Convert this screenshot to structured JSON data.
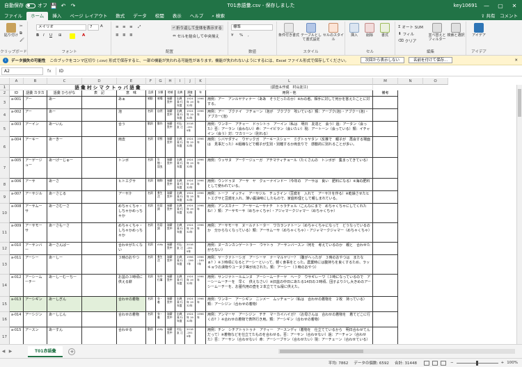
{
  "titlebar": {
    "autosave_label": "自動保存",
    "autosave_state": "オフ",
    "file_title": "T01赤語彙.csv - 保存しました",
    "user": "key10691",
    "share_label": "共有",
    "comment_label": "コメント"
  },
  "tabs": [
    "ファイル",
    "ホーム",
    "挿入",
    "ページ レイアウト",
    "数式",
    "データ",
    "校閲",
    "表示",
    "ヘルプ"
  ],
  "active_tab": "ホーム",
  "search_label": "検索",
  "ribbon": {
    "clipboard": {
      "paste": "貼り付け",
      "label": "クリップボード"
    },
    "font": {
      "name": "メイリオ",
      "size": "7",
      "label": "フォント"
    },
    "alignment": {
      "wrap": "折り返して全体を表示する",
      "merge": "セルを結合して中央揃え",
      "label": "配置"
    },
    "number": {
      "format": "標準",
      "label": "数値"
    },
    "styles": {
      "conditional": "条件付き書式",
      "table": "テーブルとして書式設定",
      "cell": "セルのスタイル",
      "label": "スタイル"
    },
    "cells": {
      "insert": "挿入",
      "delete": "削除",
      "format": "書式",
      "label": "セル"
    },
    "editing": {
      "autosum": "オート SUM",
      "fill": "フィル",
      "clear": "クリア",
      "sort": "並べ替えとフィルター",
      "find": "検索と選択",
      "label": "編集"
    },
    "ideas": {
      "ideas": "アイデア",
      "label": "アイデア"
    }
  },
  "message_bar": {
    "title": "データ損失の可能性",
    "text": "このブックをコンマ区切り (.csv) 形式で保存すると、一部の機能が失われる可能性があります。機能が失われないようにするには、Excel ファイル形式で保存してください。",
    "btn_dont_show": "次回から表示しない",
    "btn_save_as": "名前を付けて保存..."
  },
  "formula_bar": {
    "namebox": "A2",
    "fx": "fx",
    "value": "ID"
  },
  "columns": [
    "A",
    "B",
    "C",
    "D",
    "E",
    "F",
    "G",
    "H",
    "I",
    "J",
    "K",
    "L",
    "M",
    "N",
    "O"
  ],
  "sheet": {
    "title": "語 彙 村 シ マ ク ト ゥ バ 語 彙",
    "credit": "(調査＆作成　村山友江)",
    "headers": [
      "ID",
      "語彙 カタカナ",
      "語彙 ひらがな",
      "表　記",
      "意　味",
      "品詞",
      "分類",
      "地域",
      "出典",
      "調査年",
      "年",
      "用例・他",
      "備考"
    ],
    "rows": [
      {
        "id": "a-001",
        "kata": "アー",
        "hira": "あー",
        "hyoki": "",
        "imi": "あぁ",
        "hinshi": "感動",
        "bunrui": "感嘆",
        "chiiki": "瑞慶 覧中",
        "shuten": "出典発 行年度",
        "nen1": "1924年 1932年",
        "nen2": "1996年",
        "yorei": "用例：アー　アンルヤティナー（ああ　そうだったのか）※わの者。相手に対して何かを答えたことに対する。"
      },
      {
        "id": "a-002",
        "kata": "アー",
        "hira": "あー",
        "hyoki": "",
        "imi": "泡",
        "hinshi": "名詞",
        "bunrui": "自然",
        "chiiki": "瑞慶 覧中",
        "shuten": "出典発 行年度",
        "nen1": "1924年 1932年",
        "nen2": "1996年",
        "yorei": "用例：アー　ブクナイ　フチョーン（泡が　ブクブク　吹いている）類：アーブク(泡)・アブクー(泡)・アブカー(泡)"
      },
      {
        "id": "a-003",
        "kata": "アーイン",
        "hira": "あーいん",
        "hyoki": "",
        "imi": "合う",
        "hinshi": "動詞",
        "bunrui": "動作",
        "chiiki": "瑞慶 覧中",
        "shuten": "村山友 江",
        "nen1": "2018-2019年",
        "nen2": "",
        "yorei": "用例：ワンネー　アチャー　ドゥシトゥ　アーイン（私は　明日　友達と　会う）過：アータン（会った）否：アーラン（会わない）命：アーイビラン（会いたい）現：アートーン（会っている）類：イチャイン（会う）対：ワカリーン（別れる）"
      },
      {
        "id": "a-004",
        "kata": "アーキー",
        "hira": "あーきー",
        "hyoki": "",
        "imi": "両去",
        "hinshi": "名詞",
        "bunrui": "状態",
        "chiiki": "瑞慶 覧中",
        "shuten": "出典発 行年度",
        "nen1": "1924年 1932年",
        "nen2": "1996年",
        "yorei": "用例：シバヤダティ　ウヤックガ　アーキースシェー　ミグトゥヤタン（反推で　親子が　再会する場面は　見事だった）※組織などで親子が生別・別離するか両去りで　感動的に別れることが多い。"
      },
      {
        "id": "a-005",
        "kata": "アーゲージュー",
        "hira": "あーげーじゅー",
        "hyoki": "",
        "imi": "トンボ",
        "hinshi": "名詞",
        "bunrui": "生物・昆虫",
        "chiiki": "瑞慶 覧中",
        "shuten": "出典発 行年度",
        "nen1": "1924年 1932年",
        "nen2": "1996年",
        "yorei": "用例：ウッサヌ　アーケージューガ　アチマティチョール（たくさんの　トンボが　集まってきている）"
      },
      {
        "id": "a-006",
        "kata": "アーサ",
        "hira": "あーさ",
        "hyoki": "",
        "imi": "ヒトエグサ",
        "hinshi": "名詞",
        "bunrui": "植物",
        "chiiki": "瑞慶 覧中",
        "shuten": "出典発 行年度",
        "nen1": "1924年 1932年",
        "nen2": "1996年",
        "yorei": "用例：ウンドゥヌ　アーサ　ヤ　クェーナインドー（今年の　アーサは　良い　肥料になる）※海の肥料として使われている。"
      },
      {
        "id": "a-007",
        "kata": "アーサジル",
        "hira": "あーさじる",
        "hyoki": "",
        "imi": "アーサ汁",
        "hinshi": "名詞",
        "bunrui": "食生活",
        "chiiki": "瑞慶 覧中",
        "shuten": "出典発 行年度",
        "nen1": "1924年 1932年",
        "nen2": "1996年",
        "yorei": "用例：トーフ　イッティ　アーサジル　チュクイン（豆腐を　入れて　アーサ汁を作る）※乾燥させたヒトエグサと豆腐を入れ、薄い醤油味にしたもので、家庭料理として親しまれている。"
      },
      {
        "id": "a-008",
        "kata": "アーサムーサ",
        "hira": "あーさむーさ",
        "hyoki": "",
        "imi": "めちゃくちゃ・しちゃかめっちゃか",
        "hinshi": "名詞",
        "bunrui": "形容詞",
        "chiiki": "瑞慶 覧中",
        "shuten": "出典発 行年度",
        "nen1": "1924年 1932年",
        "nen2": "1996年",
        "yorei": "用例：アンスカナー　アーサームーサナチ　トゥラチェル（こんなにまで　めちゃくちゃにしてくれたね！）類：アーサモーサ（めちゃくちゃ）・アジャマークジャマー（めちゃくちゃ）"
      },
      {
        "id": "a-009",
        "kata": "アーサモーサ",
        "hira": "あーさもーさ",
        "hyoki": "",
        "imi": "めちゃくちゃ・しちゃかめっちゃか",
        "hinshi": "名詞",
        "bunrui": "形容詞",
        "chiiki": "瑞慶 覧中",
        "shuten": "出典発 行年度",
        "nen1": "1924年 1932年",
        "nen2": "1996年",
        "yorei": "用例：アーサモーサ　ヌールナトーター　ワカランナトーン（めちゃくちゃになって　どうなっているのか　分からなくなっている）類：アーサムーサ（めちゃくちゃ）・アジャマークジャマー（めちゃくちゃ）"
      },
      {
        "id": "a-010",
        "kata": "アーサンバー",
        "hira": "あーさんばー",
        "hyoki": "",
        "imi": "合わせがたくない",
        "hinshi": "名詞",
        "bunrui": "Allfy",
        "chiiki": "瑞慶 覧中",
        "shuten": "村山友 江",
        "nen1": "2018-2019年",
        "nen2": "",
        "yorei": "用例：ヌーカンカンゲートラー　ウヤトゥ　アーサンバースン（何を　考えているのか　親と　合わせたがらない）"
      },
      {
        "id": "a-011",
        "kata": "アーシー",
        "hira": "あーしー",
        "hyoki": "",
        "imi": "３時のおやつ",
        "hinshi": "名詞",
        "bunrui": "食生活",
        "chiiki": "瑞慶 覧中",
        "shuten": "出典発 行年度",
        "nen1": "1996- 1997年",
        "nen2": "1996- 1997年",
        "yorei": "用例：ヤークナトーシガ　アーシーヤ　ナーマルヤリー？（腹がへったが　３時のおやつは　またなぁ？）※３時頃になるとアーシーといって、軽く食事をとった。農業時には腹持ちを良くするため、ラッキョウの漬物やユーヌク等が出された。類：アーシー（３時のおやつ）"
      },
      {
        "id": "a-012",
        "kata": "アーシームーチー",
        "hira": "あーしーむーちー",
        "hyoki": "",
        "imi": "お盆の３時頃に供える餅",
        "hinshi": "名詞",
        "bunrui": "年中行事",
        "chiiki": "瑞慶 覧中",
        "shuten": "出典発 行年度",
        "nen1": "1924年 1932年",
        "nen2": "1996年",
        "yorei": "用例：サンジナトールムンヌ　アーシームーチーヤ　ヘーク　ウサギレーワ（３時になっているので　アーシームーチーを　早く　供えなさい）※旧盆の中日にあたる14日の３時頃、団子より少し大きめのアーシームーチーを、お墓代用の壺を２本立てて仏壇に供えた。"
      },
      {
        "id": "a-013",
        "kata": "アーシギン",
        "hira": "あーしぎん",
        "hyoki": "",
        "imi": "合わせの着物",
        "hinshi": "名詞",
        "bunrui": "衣・着",
        "chiiki": "瑞慶 覧中",
        "shuten": "出典発 行年度",
        "nen1": "1924年 1932年",
        "nen2": "1996年",
        "yorei": "用例：ワンネー　アーシギン　ニンメー　ムッチョーン（私は　合わせの着物を　２枚　持っている）類：アーシジン（合わせの着物）"
      },
      {
        "id": "a-014",
        "kata": "アーシジン",
        "hira": "あーしじん",
        "hyoki": "",
        "imi": "合わせの着物",
        "hinshi": "名詞",
        "bunrui": "衣・着",
        "chiiki": "瑞慶 覧中",
        "shuten": "出典発 行年度",
        "nen1": "1924年 1932年",
        "nen2": "1996年",
        "yorei": "用例：アンマーヤ　アーシジン　チチ　マーカイハイガ？（お母さんは　合わせの着物を　着てどこに行くの？）※合わせの着物で表所行き用。類：アーシギン（合わせの着物）"
      },
      {
        "id": "a-015",
        "kata": "アースン",
        "hira": "あーすん",
        "hyoki": "",
        "imi": "合わせる",
        "hinshi": "動詞",
        "bunrui": "Allfy",
        "chiiki": "瑞慶 覧中",
        "shuten": "村山友 江",
        "nen1": "2018-2019年",
        "nen2": "",
        "yorei": "用例：チン　シチアトゥトゥナ　アティー　アースンディ（着物を　仕立てているから　明日合わせてんだって）※着物などを仕立てたものを合わせる。否：アーサン（合わせない）過：アーチャン（合わせた）否：アーサン（合わせない）命：アーシーブサン（合わせたい）現：アーチェーン（合わせている）"
      }
    ]
  },
  "sheet_tab": "T01赤語彙",
  "status": {
    "average": "平均: 7862",
    "count": "データの個数: 6592",
    "sum": "合計: 31448",
    "zoom": "100%"
  }
}
